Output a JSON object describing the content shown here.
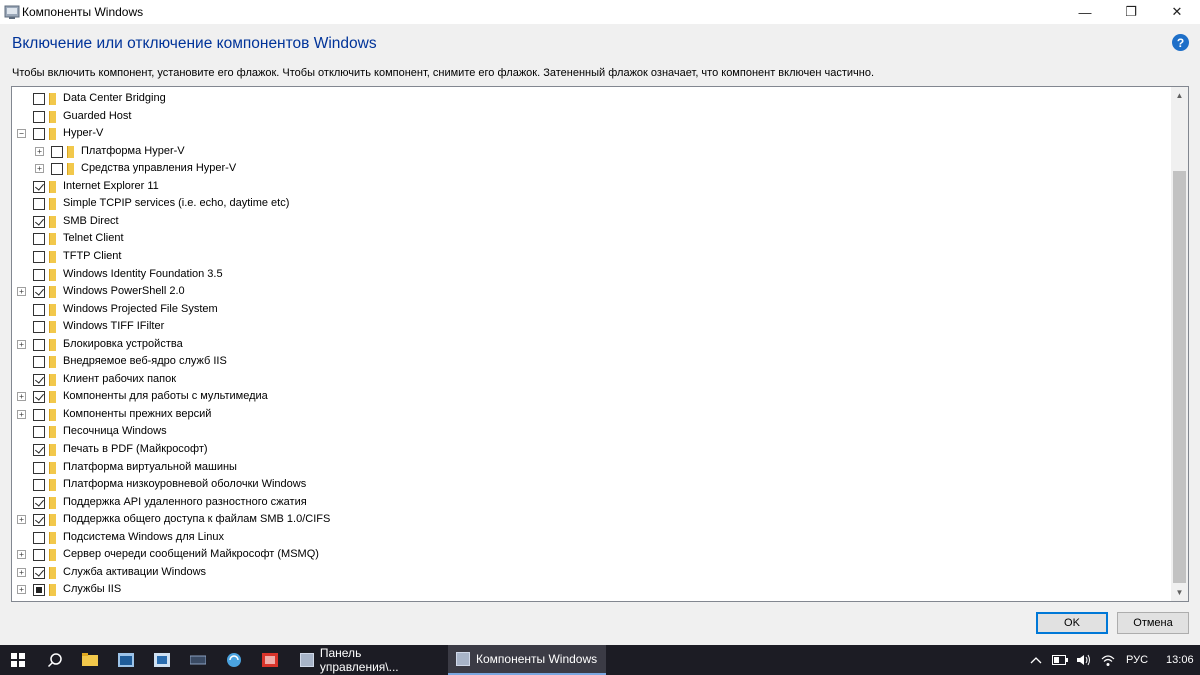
{
  "window": {
    "title": "Компоненты Windows",
    "minimize_glyph": "—",
    "restore_glyph": "❐",
    "close_glyph": "✕"
  },
  "header": {
    "heading": "Включение или отключение компонентов Windows",
    "help_glyph": "?",
    "description": "Чтобы включить компонент, установите его флажок. Чтобы отключить компонент, снимите его флажок. Затененный флажок означает, что компонент включен частично."
  },
  "tree": {
    "items": [
      {
        "label": "Data Center Bridging",
        "state": "unchecked",
        "expander": "none",
        "level": 0
      },
      {
        "label": "Guarded Host",
        "state": "unchecked",
        "expander": "none",
        "level": 0
      },
      {
        "label": "Hyper-V",
        "state": "unchecked",
        "expander": "minus",
        "level": 0
      },
      {
        "label": "Платформа Hyper-V",
        "state": "unchecked",
        "expander": "plus",
        "level": 1
      },
      {
        "label": "Средства управления Hyper-V",
        "state": "unchecked",
        "expander": "plus",
        "level": 1
      },
      {
        "label": "Internet Explorer 11",
        "state": "checked",
        "expander": "none",
        "level": 0
      },
      {
        "label": "Simple TCPIP services (i.e. echo, daytime etc)",
        "state": "unchecked",
        "expander": "none",
        "level": 0
      },
      {
        "label": "SMB Direct",
        "state": "checked",
        "expander": "none",
        "level": 0
      },
      {
        "label": "Telnet Client",
        "state": "unchecked",
        "expander": "none",
        "level": 0
      },
      {
        "label": "TFTP Client",
        "state": "unchecked",
        "expander": "none",
        "level": 0
      },
      {
        "label": "Windows Identity Foundation 3.5",
        "state": "unchecked",
        "expander": "none",
        "level": 0
      },
      {
        "label": "Windows PowerShell 2.0",
        "state": "checked",
        "expander": "plus",
        "level": 0
      },
      {
        "label": "Windows Projected File System",
        "state": "unchecked",
        "expander": "none",
        "level": 0
      },
      {
        "label": "Windows TIFF IFilter",
        "state": "unchecked",
        "expander": "none",
        "level": 0
      },
      {
        "label": "Блокировка устройства",
        "state": "unchecked",
        "expander": "plus",
        "level": 0
      },
      {
        "label": "Внедряемое веб-ядро служб IIS",
        "state": "unchecked",
        "expander": "none",
        "level": 0
      },
      {
        "label": "Клиент рабочих папок",
        "state": "checked",
        "expander": "none",
        "level": 0
      },
      {
        "label": "Компоненты для работы с мультимедиа",
        "state": "checked",
        "expander": "plus",
        "level": 0
      },
      {
        "label": "Компоненты прежних версий",
        "state": "unchecked",
        "expander": "plus",
        "level": 0
      },
      {
        "label": "Песочница Windows",
        "state": "unchecked",
        "expander": "none",
        "level": 0
      },
      {
        "label": "Печать в PDF (Майкрософт)",
        "state": "checked",
        "expander": "none",
        "level": 0
      },
      {
        "label": "Платформа виртуальной машины",
        "state": "unchecked",
        "expander": "none",
        "level": 0
      },
      {
        "label": "Платформа низкоуровневой оболочки Windows",
        "state": "unchecked",
        "expander": "none",
        "level": 0
      },
      {
        "label": "Поддержка API удаленного разностного сжатия",
        "state": "checked",
        "expander": "none",
        "level": 0
      },
      {
        "label": "Поддержка общего доступа к файлам SMB 1.0/CIFS",
        "state": "checked",
        "expander": "plus",
        "level": 0
      },
      {
        "label": "Подсистема Windows для Linux",
        "state": "unchecked",
        "expander": "none",
        "level": 0
      },
      {
        "label": "Сервер очереди сообщений Майкрософт (MSMQ)",
        "state": "unchecked",
        "expander": "plus",
        "level": 0
      },
      {
        "label": "Служба активации Windows",
        "state": "checked",
        "expander": "plus",
        "level": 0
      },
      {
        "label": "Службы IIS",
        "state": "partial",
        "expander": "plus",
        "level": 0
      }
    ],
    "scroll_up_glyph": "▲",
    "scroll_down_glyph": "▼"
  },
  "buttons": {
    "ok": "OK",
    "cancel": "Отмена"
  },
  "taskbar": {
    "tasks": [
      {
        "label": "Панель управления\\..."
      },
      {
        "label": "Компоненты Windows"
      }
    ],
    "language": "РУС",
    "time": "13:06"
  }
}
